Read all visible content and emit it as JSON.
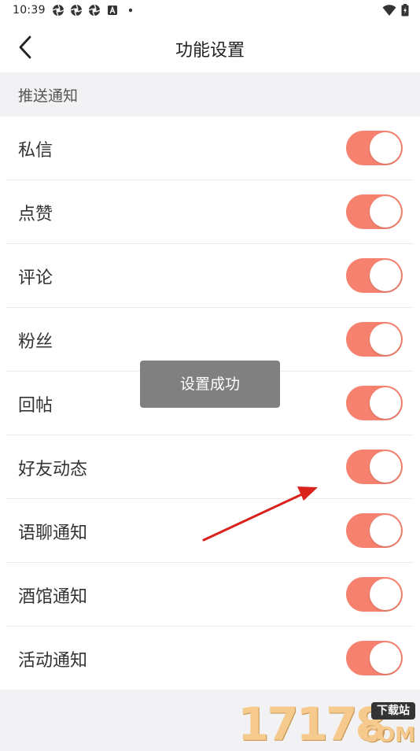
{
  "status_bar": {
    "time": "10:39",
    "left_icons": [
      "aperture-icon",
      "aperture-icon",
      "aperture-icon",
      "a-box-icon",
      "dot-icon"
    ],
    "right_icons": [
      "wifi-icon",
      "battery-icon"
    ]
  },
  "header": {
    "title": "功能设置",
    "back_icon": "chevron-left-icon"
  },
  "section": {
    "title": "推送通知"
  },
  "settings": [
    {
      "label": "私信",
      "enabled": true
    },
    {
      "label": "点赞",
      "enabled": true
    },
    {
      "label": "评论",
      "enabled": true
    },
    {
      "label": "粉丝",
      "enabled": true
    },
    {
      "label": "回帖",
      "enabled": true
    },
    {
      "label": "好友动态",
      "enabled": true
    },
    {
      "label": "语聊通知",
      "enabled": true
    },
    {
      "label": "酒馆通知",
      "enabled": true
    },
    {
      "label": "活动通知",
      "enabled": true
    }
  ],
  "toast": {
    "message": "设置成功"
  },
  "watermark": {
    "digits": "17178",
    "badge": "下载站",
    "suffix": "COM"
  },
  "colors": {
    "toggle_on": "#f5816e",
    "annotation_arrow": "#d9221c",
    "toast_bg": "#808080"
  }
}
